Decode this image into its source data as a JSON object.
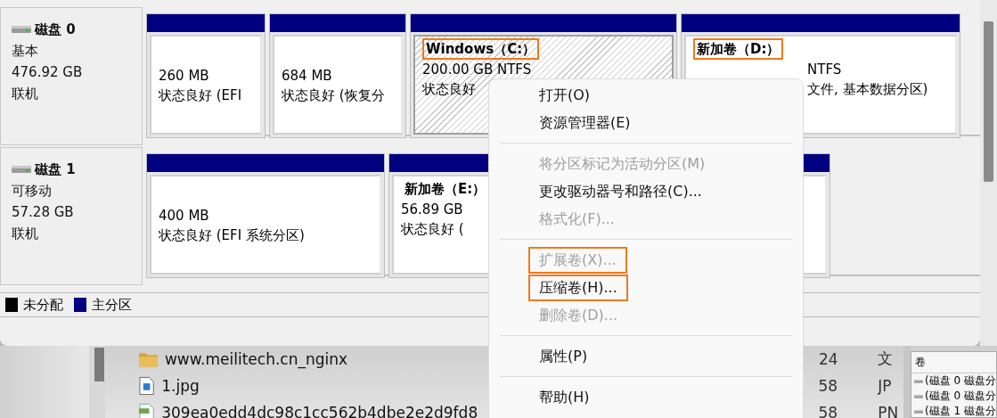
{
  "disks": [
    {
      "name": "磁盘 0",
      "type": "基本",
      "size": "476.92 GB",
      "status": "联机",
      "partitions": [
        {
          "lines": [
            "260 MB",
            "状态良好 (EFI"
          ],
          "selected": false
        },
        {
          "lines": [
            "684 MB",
            "状态良好 (恢复分"
          ],
          "selected": false
        },
        {
          "title": "Windows（C:）",
          "highlighted": true,
          "lines": [
            "200.00 GB NTFS",
            "状态良好"
          ],
          "selected": true
        },
        {
          "title": "新加卷（D:）",
          "highlighted": true,
          "covered": true,
          "lines": [
            "NTFS",
            "文件, 基本数据分区)"
          ],
          "selected": false
        }
      ]
    },
    {
      "name": "磁盘 1",
      "type": "可移动",
      "size": "57.28 GB",
      "status": "联机",
      "partitions": [
        {
          "lines": [
            "400 MB",
            "状态良好 (EFI 系统分区)"
          ],
          "selected": false
        },
        {
          "title": "新加卷（E:）",
          "highlighted": false,
          "lines": [
            "56.89 GB",
            "状态良好 ("
          ],
          "selected": false
        }
      ]
    }
  ],
  "legend": [
    {
      "label": "未分配",
      "color": "#000000"
    },
    {
      "label": "主分区",
      "color": "#000080"
    }
  ],
  "menu": [
    {
      "kind": "item",
      "label": "打开(O)",
      "disabled": false,
      "highlighted": false
    },
    {
      "kind": "item",
      "label": "资源管理器(E)",
      "disabled": false,
      "highlighted": false
    },
    {
      "kind": "separator"
    },
    {
      "kind": "item",
      "label": "将分区标记为活动分区(M)",
      "disabled": true,
      "highlighted": false
    },
    {
      "kind": "item",
      "label": "更改驱动器号和路径(C)...",
      "disabled": false,
      "highlighted": false
    },
    {
      "kind": "item",
      "label": "格式化(F)...",
      "disabled": true,
      "highlighted": false
    },
    {
      "kind": "separator"
    },
    {
      "kind": "item",
      "label": "扩展卷(X)...",
      "disabled": true,
      "highlighted": true
    },
    {
      "kind": "item",
      "label": "压缩卷(H)...",
      "disabled": false,
      "highlighted": true
    },
    {
      "kind": "item",
      "label": "删除卷(D)...",
      "disabled": true,
      "highlighted": false
    },
    {
      "kind": "separator"
    },
    {
      "kind": "item",
      "label": "属性(P)",
      "disabled": false,
      "highlighted": false
    },
    {
      "kind": "separator"
    },
    {
      "kind": "item",
      "label": "帮助(H)",
      "disabled": false,
      "highlighted": false
    }
  ],
  "files": [
    {
      "kind": "folder",
      "name": "www.meilitech.cn_nginx",
      "column_2": "24",
      "column_3": "文"
    },
    {
      "kind": "image",
      "name": "1.jpg",
      "column_2": "58",
      "column_3": "JP"
    },
    {
      "kind": "png",
      "name": "309ea0edd4dc98c1cc562b4dbe2e2d9fd8",
      "column_2": "58",
      "column_3": "PN"
    }
  ],
  "volume_panel": {
    "header": "卷",
    "rows": [
      "(磁盘 0 磁盘分",
      "(磁盘 0 磁盘分",
      "(磁盘 1 磁盘分"
    ]
  }
}
